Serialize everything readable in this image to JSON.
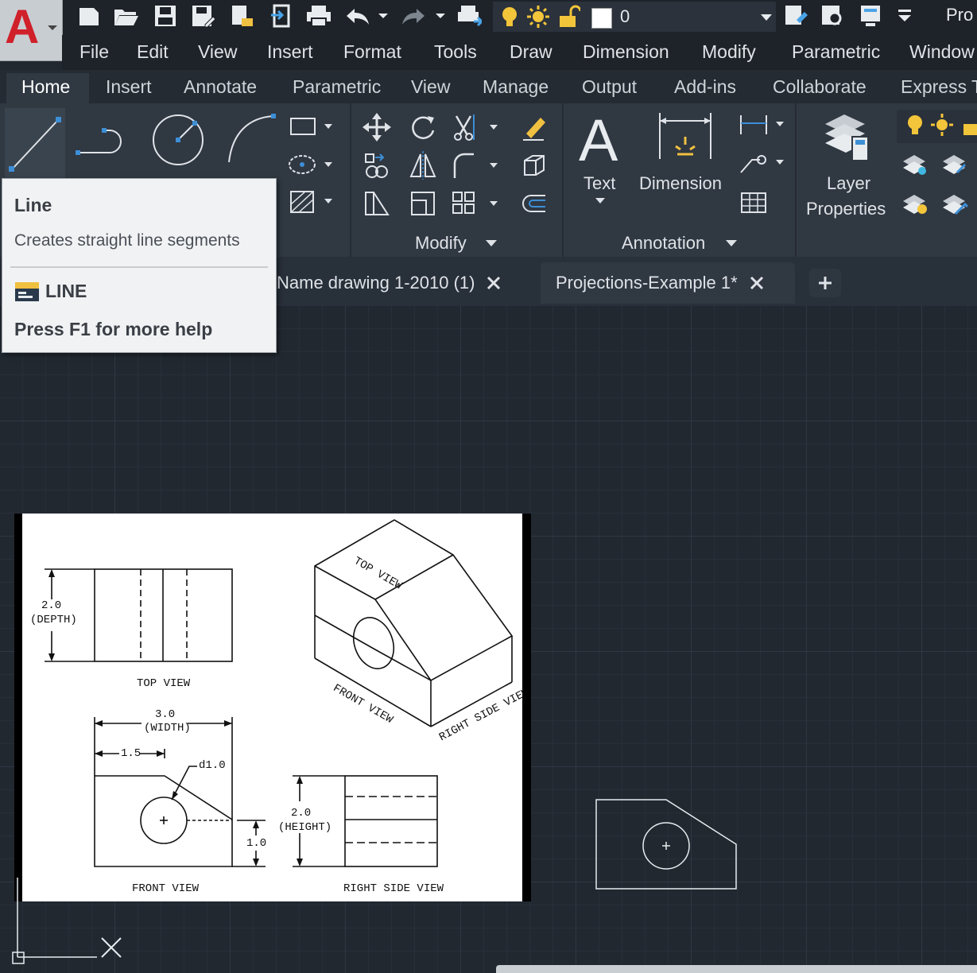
{
  "app": {
    "logo_letter": "A"
  },
  "quick_access": {
    "layer_name": "0",
    "right_text": "Pro",
    "icons": [
      "new-icon",
      "open-icon",
      "save-icon",
      "save-as-icon",
      "publish-icon",
      "import-icon",
      "print-icon",
      "undo-icon",
      "redo-icon",
      "plot-icon",
      "lightbulb-icon",
      "sun-icon",
      "unlock-icon",
      "color-swatch-icon"
    ]
  },
  "menu": [
    "File",
    "Edit",
    "View",
    "Insert",
    "Format",
    "Tools",
    "Draw",
    "Dimension",
    "Modify",
    "Parametric",
    "Window"
  ],
  "ribbon_tabs": [
    "Home",
    "Insert",
    "Annotate",
    "Parametric",
    "View",
    "Manage",
    "Output",
    "Add-ins",
    "Collaborate",
    "Express T"
  ],
  "ribbon": {
    "modify_title": "Modify",
    "annotation_title": "Annotation",
    "text_label": "Text",
    "dimension_label": "Dimension",
    "layer_label_1": "Layer",
    "layer_label_2": "Properties"
  },
  "tooltip": {
    "title": "Line",
    "description": "Creates straight line segments",
    "command": "LINE",
    "help": "Press F1 for more help"
  },
  "doc_tabs": [
    {
      "label": "Name drawing 1-2010 (1)"
    },
    {
      "label": "Projections-Example 1*"
    }
  ],
  "drawing": {
    "top_view": "TOP VIEW",
    "front_view": "FRONT VIEW",
    "right_side_view": "RIGHT SIDE VIEW",
    "depth_value": "2.0",
    "depth_label": "(DEPTH)",
    "width_value": "3.0",
    "width_label": "(WIDTH)",
    "half_width": "1.5",
    "diameter": "d1.0",
    "height_value": "2.0",
    "height_label": "(HEIGHT)",
    "base_height": "1.0",
    "iso_top": "TOP VIEW",
    "iso_front": "FRONT VIEW",
    "iso_right": "RIGHT SIDE VIEW"
  },
  "colors": {
    "accent_blue": "#3d8fd6",
    "icon_yellow": "#f0c040",
    "canvas_bg": "#212830"
  }
}
